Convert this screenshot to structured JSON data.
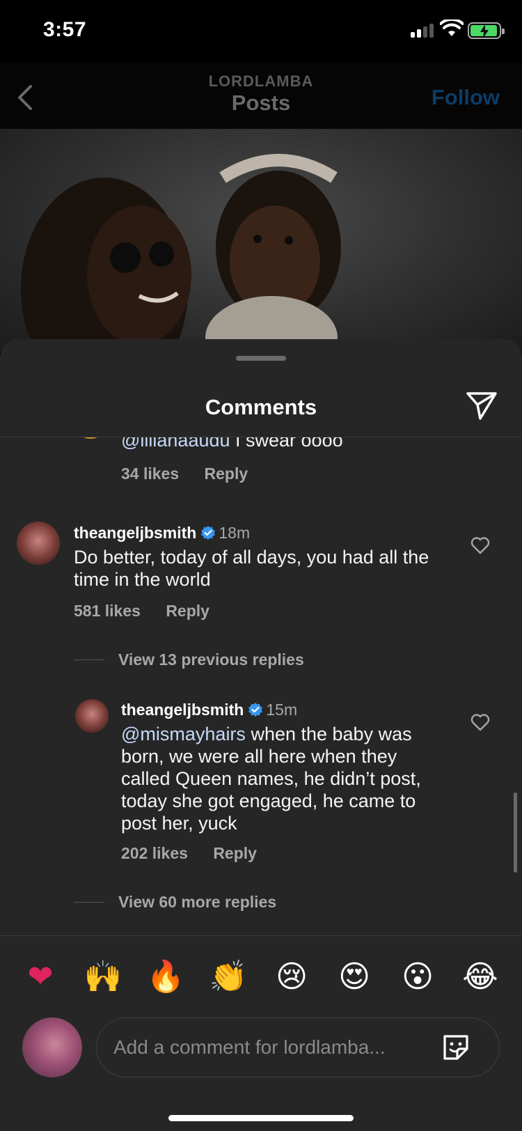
{
  "status_bar": {
    "time": "3:57"
  },
  "nav": {
    "username": "LORDLAMBA",
    "title": "Posts",
    "follow_label": "Follow"
  },
  "sheet": {
    "title": "Comments"
  },
  "comments": [
    {
      "text_mention": "@lilianaaudu",
      "text": " I swear oooo",
      "likes": "34 likes",
      "reply_label": "Reply"
    },
    {
      "username": "theangeljbsmith",
      "time": "18m",
      "text": "Do better, today of all days, you had all the time in the world",
      "likes": "581 likes",
      "reply_label": "Reply",
      "view_replies": "View 13 previous replies"
    },
    {
      "username": "theangeljbsmith",
      "time": "15m",
      "text_mention": "@mismayhairs",
      "text": " when the baby was born, we were all here when they called Queen names, he didn’t post, today she got engaged, he came to post her, yuck",
      "likes": "202 likes",
      "reply_label": "Reply",
      "view_replies": "View 60 more replies"
    }
  ],
  "emoji_bar": [
    {
      "name": "heart-emoji",
      "char": "❤"
    },
    {
      "name": "raised-hands-emoji",
      "char": "🙌"
    },
    {
      "name": "fire-emoji",
      "char": "🔥"
    },
    {
      "name": "clap-emoji",
      "char": "👏"
    },
    {
      "name": "crying-emoji",
      "char": "😢"
    },
    {
      "name": "heart-eyes-emoji",
      "char": "😍"
    },
    {
      "name": "surprised-emoji",
      "char": "😮"
    },
    {
      "name": "laughing-emoji",
      "char": "😂"
    }
  ],
  "composer": {
    "placeholder": "Add a comment for lordlamba..."
  },
  "colors": {
    "sheet_bg": "#262626",
    "follow": "#0095f6",
    "verified": "#3897f0"
  }
}
